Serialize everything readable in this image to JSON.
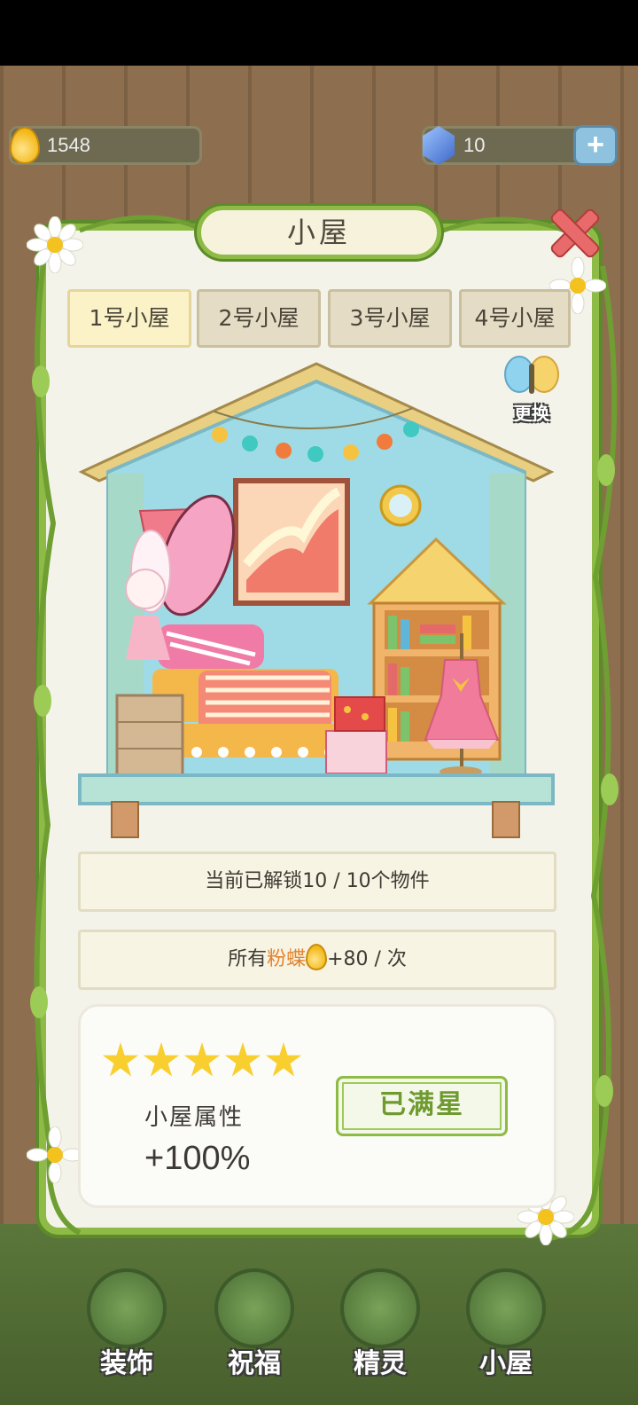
{
  "currency": {
    "drops": "1548",
    "gems": "10",
    "plus_label": "+"
  },
  "modal": {
    "title": "小屋",
    "tabs": [
      {
        "label": "1号小屋"
      },
      {
        "label": "2号小屋"
      },
      {
        "label": "3号小屋"
      },
      {
        "label": "4号小屋"
      }
    ],
    "active_tab": 0,
    "swap_label": "更换",
    "unlocked_text": "当前已解锁10 / 10个物件",
    "bonus_prefix": "所有",
    "bonus_highlight": "粉蝶",
    "bonus_suffix": "+80 / 次",
    "stars_filled": 5,
    "stars_total": 5,
    "attr_label": "小屋属性",
    "attr_value": "+100%",
    "maxed_label": "已满星"
  },
  "nav": [
    {
      "label": "装饰"
    },
    {
      "label": "祝福"
    },
    {
      "label": "精灵"
    },
    {
      "label": "小屋"
    }
  ],
  "colors": {
    "vine_green": "#8dbb45",
    "accent_orange": "#e2832f",
    "star_yellow": "#f8cf2f",
    "close_red": "#e86a6a"
  },
  "icons": [
    "drop-icon",
    "gem-icon",
    "plus-icon",
    "close-icon",
    "swap-butterfly-icon",
    "star-icon",
    "flower-icon"
  ]
}
